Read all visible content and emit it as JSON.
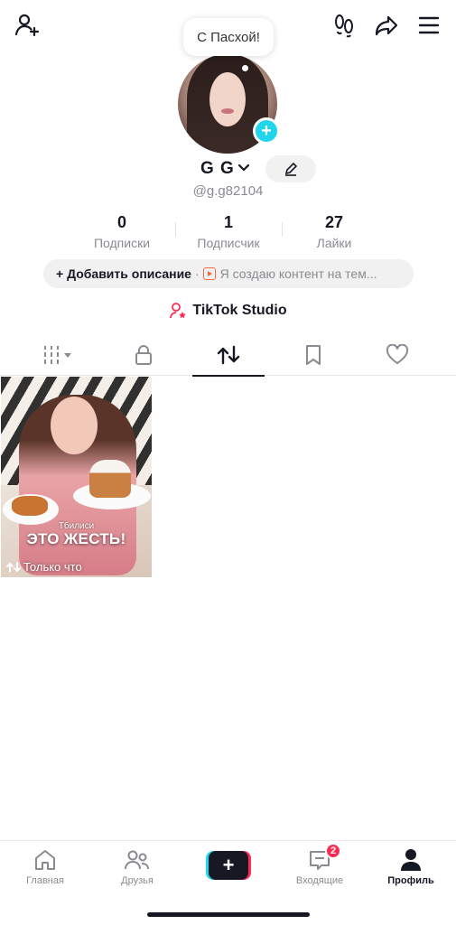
{
  "header": {
    "icons": [
      "add-user-icon",
      "footprints-icon",
      "share-icon",
      "menu-icon"
    ],
    "bubble_text": "С Пасхой!"
  },
  "profile": {
    "name": "G G",
    "handle": "@g.g82104",
    "stats": [
      {
        "value": "0",
        "label": "Подписки"
      },
      {
        "value": "1",
        "label": "Подписчик"
      },
      {
        "value": "27",
        "label": "Лайки"
      }
    ],
    "bio_add": "+ Добавить описание",
    "bio_separator": "·",
    "bio_creator": "Я создаю контент на тем...",
    "studio": "TikTok Studio"
  },
  "tabs": [
    "videos-grid-icon",
    "lock-icon",
    "repost-icon",
    "bookmark-icon",
    "heart-icon"
  ],
  "active_tab": "repost",
  "video": {
    "caption_small": "Тбилиси",
    "caption_big": "ЭТО ЖЕСТЬ!",
    "meta": "Только что"
  },
  "nav": {
    "items": [
      {
        "label": "Главная"
      },
      {
        "label": "Друзья"
      },
      {
        "label": "Входящие"
      },
      {
        "label": "Профиль"
      }
    ],
    "inbox_badge": "2"
  },
  "colors": {
    "accent_cyan": "#20d5ec",
    "accent_red": "#fe2c55",
    "text": "#161823",
    "muted": "#8a8b91"
  }
}
